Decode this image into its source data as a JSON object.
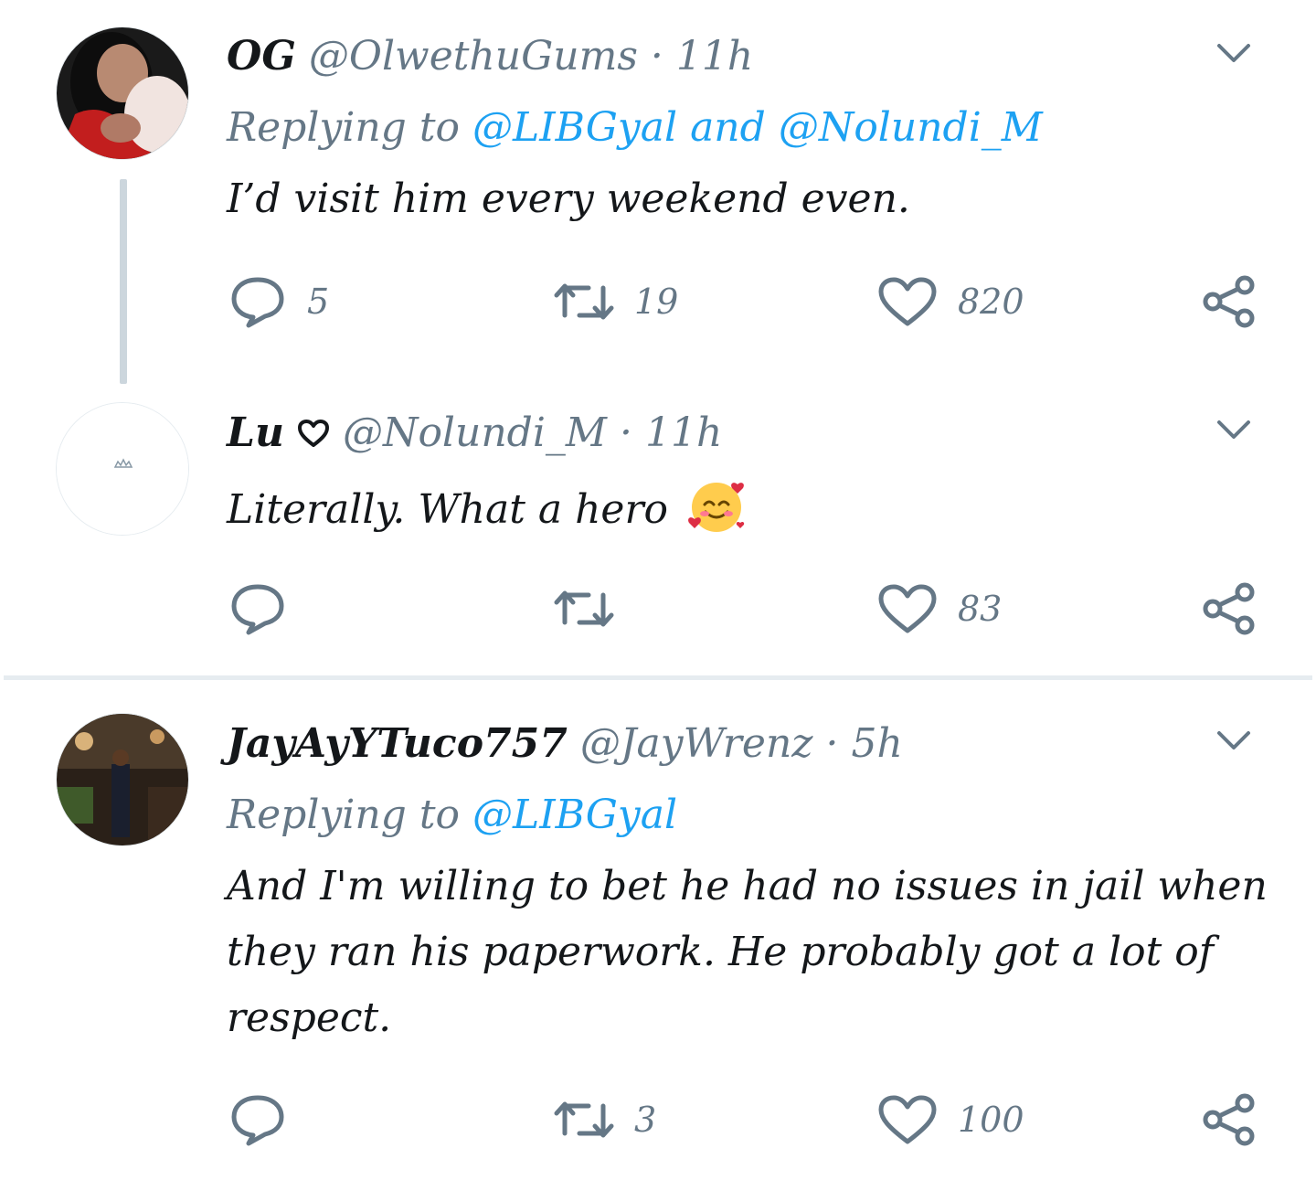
{
  "tweets": [
    {
      "name": "OG",
      "handle": "@OlwethuGums",
      "separator": "·",
      "time": "11h",
      "replying_prefix": "Replying to",
      "replying_mentions": [
        "@LIBGyal",
        "@Nolundi_M"
      ],
      "replying_joiner": "and",
      "text": "I’d visit him every weekend even.",
      "replies": "5",
      "retweets": "19",
      "likes": "820"
    },
    {
      "name": "Lu",
      "handle": "@Nolundi_M",
      "separator": "·",
      "time": "11h",
      "text": "Literally. What a hero",
      "replies": "",
      "retweets": "",
      "likes": "83"
    },
    {
      "name": "JayAyYTuco757",
      "handle": "@JayWrenz",
      "separator": "·",
      "time": "5h",
      "replying_prefix": "Replying to",
      "replying_mentions": [
        "@LIBGyal"
      ],
      "text": "And I'm willing to bet he had no issues in jail when they ran his paperwork. He probably got a lot of respect.",
      "replies": "",
      "retweets": "3",
      "likes": "100"
    }
  ],
  "colors": {
    "text": "#14171a",
    "secondary": "#657786",
    "link": "#1da1f2",
    "divider": "#e6ecf0",
    "thread_line": "#ccd6dd"
  },
  "icons": [
    "reply-icon",
    "retweet-icon",
    "like-icon",
    "share-icon",
    "chevron-down-icon",
    "heart-outline-icon",
    "smiling-face-with-hearts-emoji"
  ]
}
